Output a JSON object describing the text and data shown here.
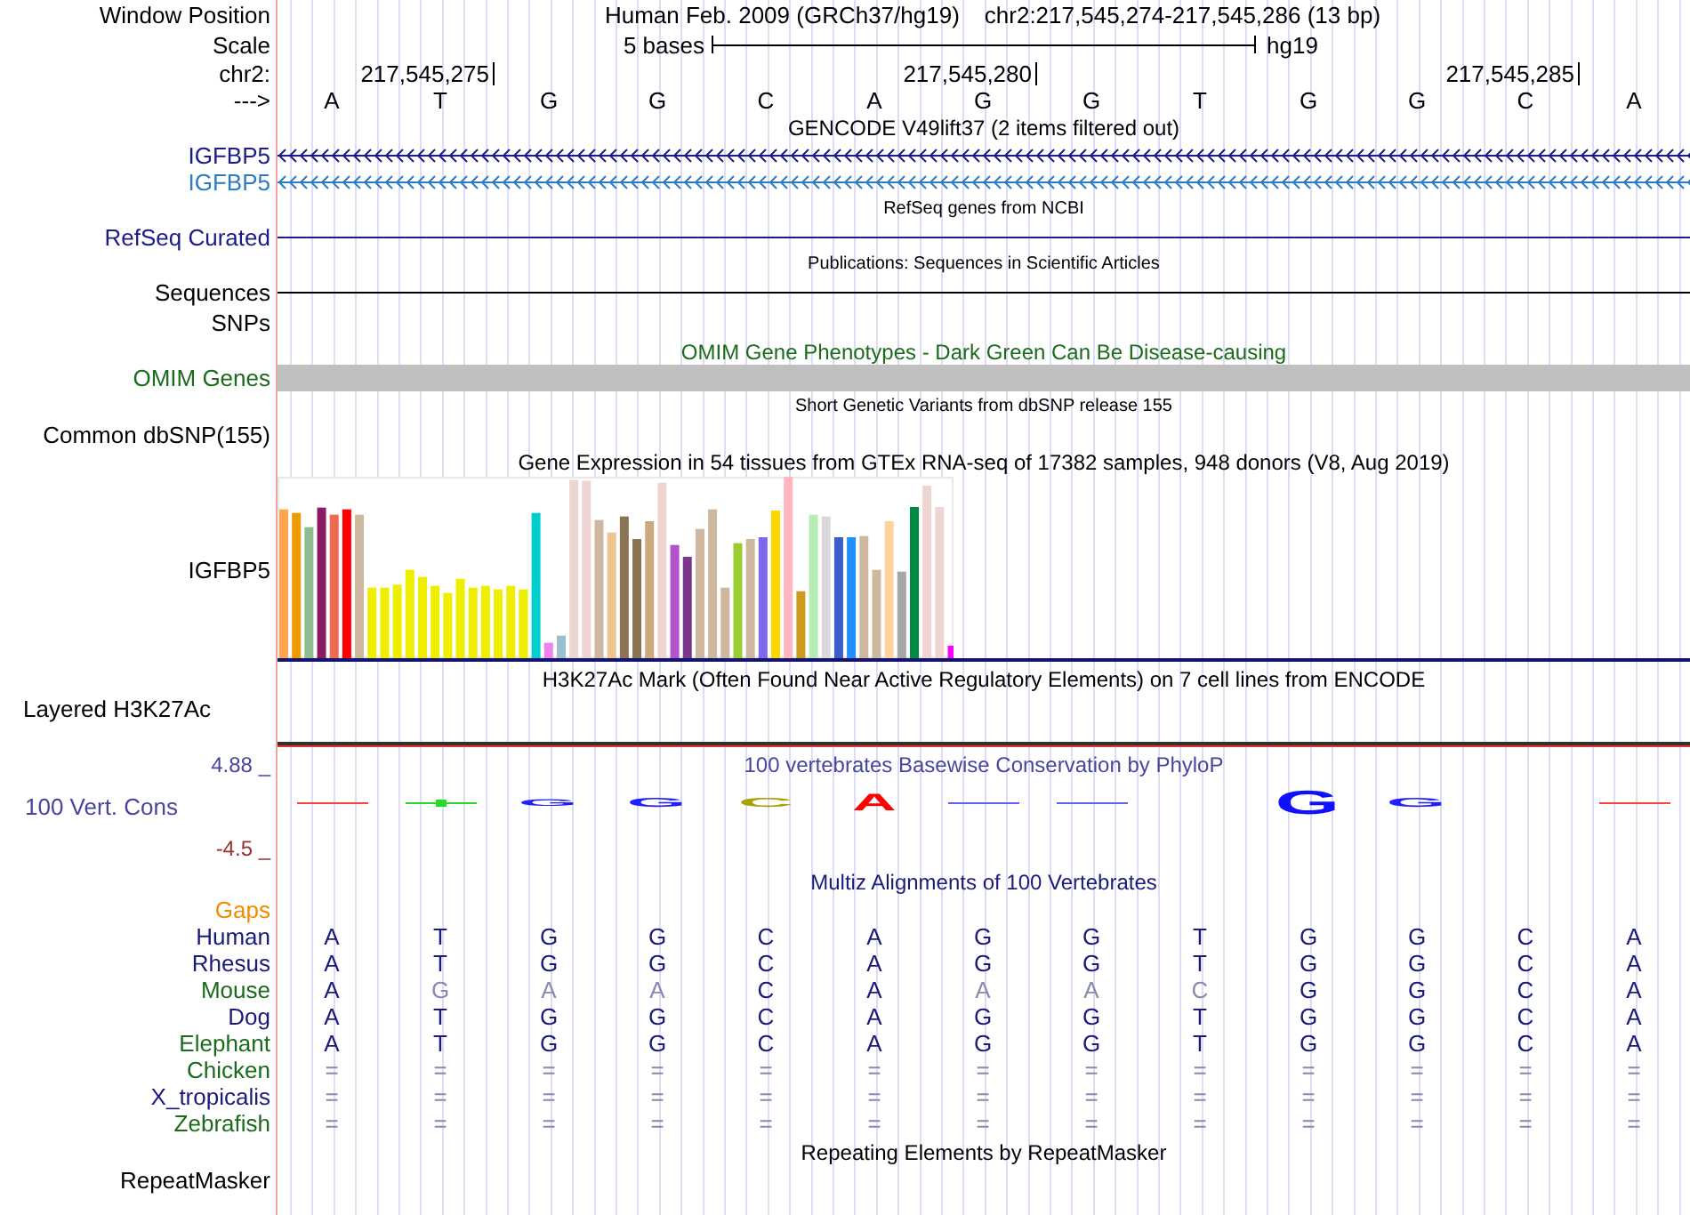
{
  "window_position": {
    "label": "Window Position",
    "assembly": "Human Feb. 2009 (GRCh37/hg19)",
    "range": "chr2:217,545,274-217,545,286 (13 bp)"
  },
  "scale": {
    "label": "Scale",
    "text": "5 bases",
    "assembly": "hg19"
  },
  "chromosome": {
    "label": "chr2:",
    "positions": [
      "217,545,275",
      "217,545,280",
      "217,545,285"
    ]
  },
  "strand": {
    "label": "--->",
    "bases": [
      "A",
      "T",
      "G",
      "G",
      "C",
      "A",
      "G",
      "G",
      "T",
      "G",
      "G",
      "C",
      "A"
    ]
  },
  "gencode": {
    "title": "GENCODE V49lift37 (2 items filtered out)",
    "genes": [
      {
        "name": "IGFBP5",
        "color": "#1a1a8c"
      },
      {
        "name": "IGFBP5",
        "color": "#2a7cc4"
      }
    ]
  },
  "refseq": {
    "title": "RefSeq genes from NCBI",
    "label": "RefSeq Curated"
  },
  "publications": {
    "title": "Publications: Sequences in Scientific Articles",
    "label": "Sequences"
  },
  "snps": {
    "label": "SNPs"
  },
  "omim": {
    "title": "OMIM Gene Phenotypes - Dark Green Can Be Disease-causing",
    "label": "OMIM Genes"
  },
  "dbsnp": {
    "title": "Short Genetic Variants from dbSNP release 155",
    "label": "Common dbSNP(155)"
  },
  "gtex": {
    "title": "Gene Expression in 54 tissues from GTEx RNA-seq of 17382 samples, 948 donors (V8, Aug 2019)",
    "label": "IGFBP5"
  },
  "h3k27ac": {
    "title": "H3K27Ac Mark (Often Found Near Active Regulatory Elements) on 7 cell lines from ENCODE",
    "label": "Layered H3K27Ac"
  },
  "conservation": {
    "title": "100 vertebrates Basewise Conservation by PhyloP",
    "label": "100 Vert. Cons",
    "max": "4.88 _",
    "min": "-4.5 _",
    "logo": [
      {
        "kind": "line",
        "color": "#ff4040"
      },
      {
        "kind": "dot_line",
        "color": "#22dd22"
      },
      {
        "kind": "letter",
        "text": "G",
        "color": "#2020ff"
      },
      {
        "kind": "letter",
        "text": "G",
        "color": "#2020ff"
      },
      {
        "kind": "letter",
        "text": "C",
        "color": "#aaa000"
      },
      {
        "kind": "letter",
        "text": "A",
        "color": "#ff0000"
      },
      {
        "kind": "line",
        "color": "#6060ff"
      },
      {
        "kind": "line",
        "color": "#6060ff"
      },
      {
        "kind": "blank"
      },
      {
        "kind": "letter",
        "text": "G",
        "color": "#1010ff"
      },
      {
        "kind": "letter",
        "text": "G",
        "color": "#2020ff"
      },
      {
        "kind": "blank"
      },
      {
        "kind": "line",
        "color": "#ff4040"
      }
    ]
  },
  "multiz": {
    "title": "Multiz Alignments of 100 Vertebrates",
    "gaps_label": "Gaps",
    "species": [
      {
        "name": "Human",
        "color": "#1a1a7a",
        "bases": [
          {
            "text": "A",
            "faded": false
          },
          {
            "text": "T",
            "faded": false
          },
          {
            "text": "G",
            "faded": false
          },
          {
            "text": "G",
            "faded": false
          },
          {
            "text": "C",
            "faded": false
          },
          {
            "text": "A",
            "faded": false
          },
          {
            "text": "G",
            "faded": false
          },
          {
            "text": "G",
            "faded": false
          },
          {
            "text": "T",
            "faded": false
          },
          {
            "text": "G",
            "faded": false
          },
          {
            "text": "G",
            "faded": false
          },
          {
            "text": "C",
            "faded": false
          },
          {
            "text": "A",
            "faded": false
          }
        ]
      },
      {
        "name": "Rhesus",
        "color": "#1a1a7a",
        "bases": [
          {
            "text": "A",
            "faded": false
          },
          {
            "text": "T",
            "faded": false
          },
          {
            "text": "G",
            "faded": false
          },
          {
            "text": "G",
            "faded": false
          },
          {
            "text": "C",
            "faded": false
          },
          {
            "text": "A",
            "faded": false
          },
          {
            "text": "G",
            "faded": false
          },
          {
            "text": "G",
            "faded": false
          },
          {
            "text": "T",
            "faded": false
          },
          {
            "text": "G",
            "faded": false
          },
          {
            "text": "G",
            "faded": false
          },
          {
            "text": "C",
            "faded": false
          },
          {
            "text": "A",
            "faded": false
          }
        ]
      },
      {
        "name": "Mouse",
        "color": "#1a6b1a",
        "bases": [
          {
            "text": "A",
            "faded": false
          },
          {
            "text": "G",
            "faded": true
          },
          {
            "text": "A",
            "faded": true
          },
          {
            "text": "A",
            "faded": true
          },
          {
            "text": "C",
            "faded": false
          },
          {
            "text": "A",
            "faded": false
          },
          {
            "text": "A",
            "faded": true
          },
          {
            "text": "A",
            "faded": true
          },
          {
            "text": "C",
            "faded": true
          },
          {
            "text": "G",
            "faded": false
          },
          {
            "text": "G",
            "faded": false
          },
          {
            "text": "C",
            "faded": false
          },
          {
            "text": "A",
            "faded": false
          }
        ]
      },
      {
        "name": "Dog",
        "color": "#1a1a7a",
        "bases": [
          {
            "text": "A",
            "faded": false
          },
          {
            "text": "T",
            "faded": false
          },
          {
            "text": "G",
            "faded": false
          },
          {
            "text": "G",
            "faded": false
          },
          {
            "text": "C",
            "faded": false
          },
          {
            "text": "A",
            "faded": false
          },
          {
            "text": "G",
            "faded": false
          },
          {
            "text": "G",
            "faded": false
          },
          {
            "text": "T",
            "faded": false
          },
          {
            "text": "G",
            "faded": false
          },
          {
            "text": "G",
            "faded": false
          },
          {
            "text": "C",
            "faded": false
          },
          {
            "text": "A",
            "faded": false
          }
        ]
      },
      {
        "name": "Elephant",
        "color": "#1a6b1a",
        "bases": [
          {
            "text": "A",
            "faded": false
          },
          {
            "text": "T",
            "faded": false
          },
          {
            "text": "G",
            "faded": false
          },
          {
            "text": "G",
            "faded": false
          },
          {
            "text": "C",
            "faded": false
          },
          {
            "text": "A",
            "faded": false
          },
          {
            "text": "G",
            "faded": false
          },
          {
            "text": "G",
            "faded": false
          },
          {
            "text": "T",
            "faded": false
          },
          {
            "text": "G",
            "faded": false
          },
          {
            "text": "G",
            "faded": false
          },
          {
            "text": "C",
            "faded": false
          },
          {
            "text": "A",
            "faded": false
          }
        ]
      },
      {
        "name": "Chicken",
        "color": "#1a6b1a",
        "bases": [
          {
            "text": "=",
            "faded": true
          },
          {
            "text": "=",
            "faded": true
          },
          {
            "text": "=",
            "faded": true
          },
          {
            "text": "=",
            "faded": true
          },
          {
            "text": "=",
            "faded": true
          },
          {
            "text": "=",
            "faded": true
          },
          {
            "text": "=",
            "faded": true
          },
          {
            "text": "=",
            "faded": true
          },
          {
            "text": "=",
            "faded": true
          },
          {
            "text": "=",
            "faded": true
          },
          {
            "text": "=",
            "faded": true
          },
          {
            "text": "=",
            "faded": true
          },
          {
            "text": "=",
            "faded": true
          }
        ]
      },
      {
        "name": "X_tropicalis",
        "color": "#1a1a7a",
        "bases": [
          {
            "text": "=",
            "faded": true
          },
          {
            "text": "=",
            "faded": true
          },
          {
            "text": "=",
            "faded": true
          },
          {
            "text": "=",
            "faded": true
          },
          {
            "text": "=",
            "faded": true
          },
          {
            "text": "=",
            "faded": true
          },
          {
            "text": "=",
            "faded": true
          },
          {
            "text": "=",
            "faded": true
          },
          {
            "text": "=",
            "faded": true
          },
          {
            "text": "=",
            "faded": true
          },
          {
            "text": "=",
            "faded": true
          },
          {
            "text": "=",
            "faded": true
          },
          {
            "text": "=",
            "faded": true
          }
        ]
      },
      {
        "name": "Zebrafish",
        "color": "#1a6b1a",
        "bases": [
          {
            "text": "=",
            "faded": true
          },
          {
            "text": "=",
            "faded": true
          },
          {
            "text": "=",
            "faded": true
          },
          {
            "text": "=",
            "faded": true
          },
          {
            "text": "=",
            "faded": true
          },
          {
            "text": "=",
            "faded": true
          },
          {
            "text": "=",
            "faded": true
          },
          {
            "text": "=",
            "faded": true
          },
          {
            "text": "=",
            "faded": true
          },
          {
            "text": "=",
            "faded": true
          },
          {
            "text": "=",
            "faded": true
          },
          {
            "text": "=",
            "faded": true
          },
          {
            "text": "=",
            "faded": true
          }
        ]
      }
    ]
  },
  "repeatmasker": {
    "title": "Repeating Elements by RepeatMasker",
    "label": "RepeatMasker"
  }
}
